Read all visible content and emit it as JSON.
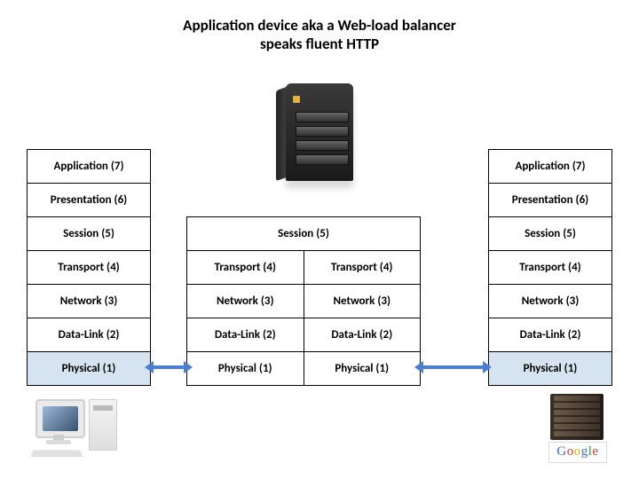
{
  "title": {
    "line1": "Application device aka a Web-load balancer",
    "line2": "speaks fluent HTTP"
  },
  "layers": {
    "application": "Application (7)",
    "presentation": "Presentation (6)",
    "session": "Session (5)",
    "transport": "Transport (4)",
    "network": "Network (3)",
    "datalink": "Data-Link (2)",
    "physical": "Physical (1)"
  },
  "assets": {
    "device_name": "network-appliance",
    "client_name": "desktop-pc",
    "backend_name": "server-rack",
    "logo_chars": {
      "c1": "G",
      "c2": "o",
      "c3": "o",
      "c4": "g",
      "c5": "l",
      "c6": "e"
    }
  },
  "arrows": {
    "left": "bidirectional",
    "right": "bidirectional"
  },
  "colors": {
    "arrow": "#4a7fd8",
    "highlight_row": "#d6e4f2"
  }
}
